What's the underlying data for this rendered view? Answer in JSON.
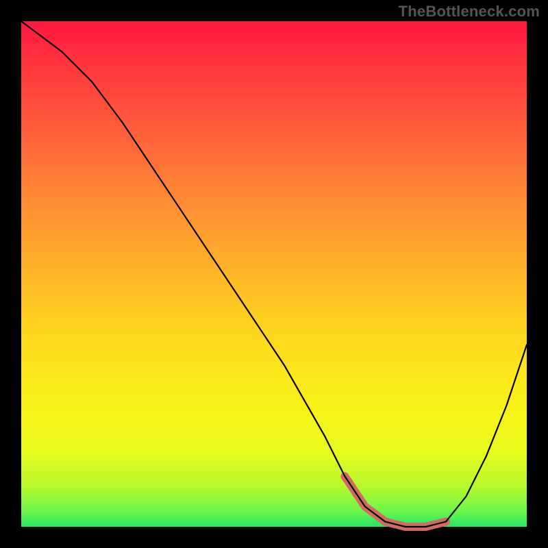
{
  "watermark": "TheBottleneck.com",
  "chart_data": {
    "type": "line",
    "title": "",
    "xlabel": "",
    "ylabel": "",
    "xlim": [
      0,
      100
    ],
    "ylim": [
      0,
      100
    ],
    "grid": false,
    "series": [
      {
        "name": "curve",
        "x": [
          0,
          4,
          8,
          14,
          20,
          28,
          36,
          44,
          52,
          60,
          64,
          68,
          72,
          76,
          80,
          84,
          88,
          92,
          96,
          100
        ],
        "values": [
          100,
          97,
          94,
          88,
          80,
          68,
          56,
          44,
          32,
          18,
          10,
          4,
          1,
          0,
          0,
          1,
          6,
          14,
          24,
          36
        ]
      }
    ],
    "highlight_region": {
      "x": [
        64,
        84
      ],
      "values": [
        10,
        4,
        1,
        0,
        0,
        1
      ]
    },
    "background_gradient": {
      "top": "#ff173f",
      "bottom": "#21e765",
      "description": "red-orange-yellow-green vertical gradient"
    }
  }
}
